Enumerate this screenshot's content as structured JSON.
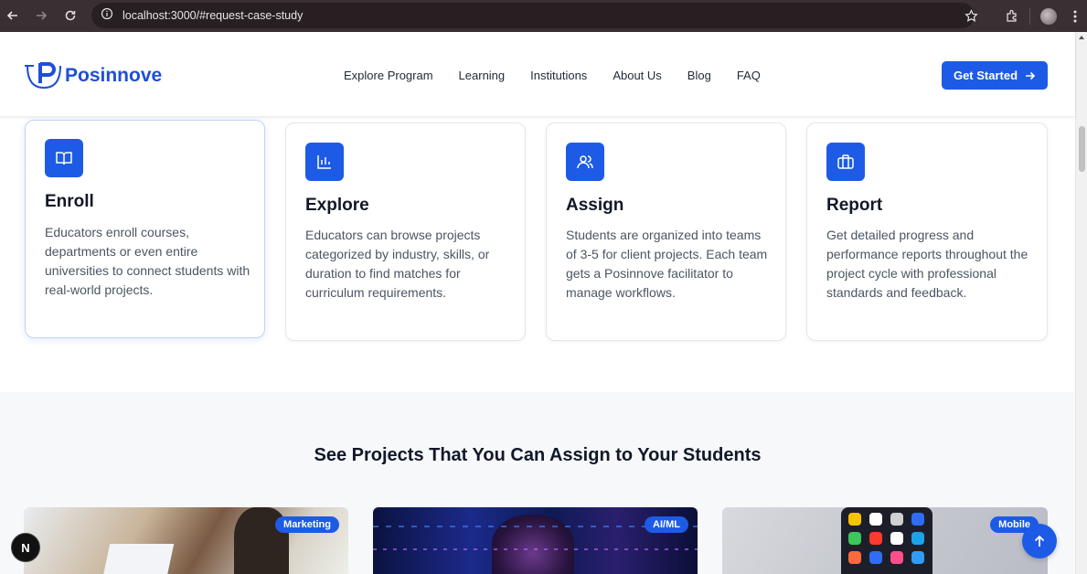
{
  "browser": {
    "url": "localhost:3000/#request-case-study"
  },
  "header": {
    "logo_text": "Posinnove",
    "nav": [
      "Explore Program",
      "Learning",
      "Institutions",
      "About Us",
      "Blog",
      "FAQ"
    ],
    "cta_label": "Get Started"
  },
  "steps": [
    {
      "title": "Enroll",
      "desc": "Educators enroll courses, departments or even entire universities to connect students with real-world projects.",
      "icon": "book-open-icon"
    },
    {
      "title": "Explore",
      "desc": "Educators can browse projects categorized by industry, skills, or duration to find matches for curriculum requirements.",
      "icon": "bar-chart-icon"
    },
    {
      "title": "Assign",
      "desc": "Students are organized into teams of 3-5 for client projects. Each team gets a Posinnove facilitator to manage workflows.",
      "icon": "users-icon"
    },
    {
      "title": "Report",
      "desc": "Get detailed progress and performance reports throughout the project cycle with professional standards and feedback.",
      "icon": "briefcase-icon"
    }
  ],
  "projects": {
    "title": "See Projects That You Can Assign to Your Students",
    "cards": [
      {
        "badge": "Marketing"
      },
      {
        "badge": "AI/ML"
      },
      {
        "badge": "Mobile"
      }
    ]
  },
  "floating": {
    "next_badge": "N"
  },
  "colors": {
    "brand": "#1d5be6",
    "chrome": "#3a3034",
    "section_bg": "#f7f8fa"
  }
}
